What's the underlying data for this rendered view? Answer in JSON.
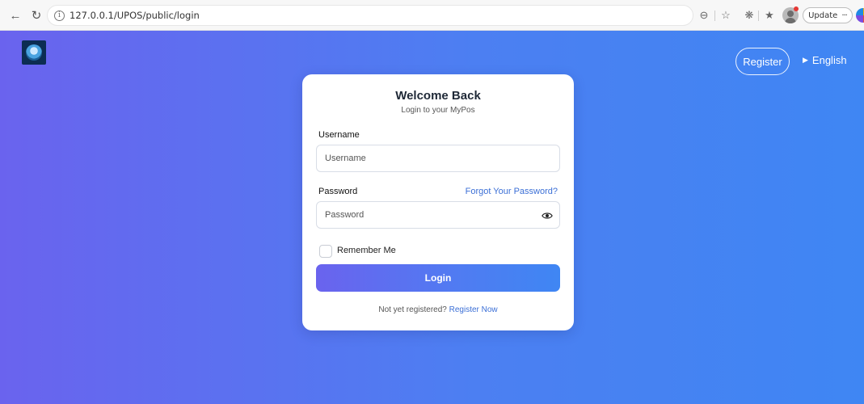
{
  "browser": {
    "url": "127.0.0.1/UPOS/public/login",
    "update_label": "Update",
    "update_more": "···"
  },
  "header": {
    "register_label": "Register",
    "language_label": "English"
  },
  "login_card": {
    "title": "Welcome Back",
    "subtitle": "Login to your MyPos",
    "username_label": "Username",
    "username_placeholder": "Username",
    "password_label": "Password",
    "password_placeholder": "Password",
    "forgot_password": "Forgot Your Password?",
    "remember_me": "Remember Me",
    "login_button": "Login",
    "register_prompt": "Not yet registered?",
    "register_link": "Register Now"
  },
  "colors": {
    "gradient_start": "#6a63ee",
    "gradient_end": "#3f86f3",
    "link": "#3b6fd6"
  }
}
